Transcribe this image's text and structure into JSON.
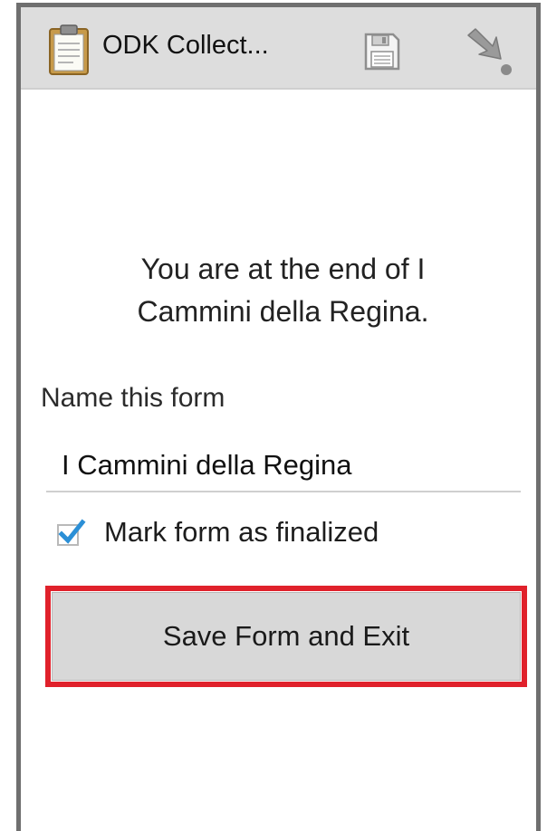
{
  "action_bar": {
    "title": "ODK Collect...",
    "app_icon": "clipboard-icon",
    "save_icon": "floppy-disk-icon",
    "go_icon": "arrow-to-point-icon"
  },
  "end_screen": {
    "message_line1": "You are at the end of I",
    "message_line2": "Cammini della Regina."
  },
  "form_name": {
    "label": "Name this form",
    "value": "I Cammini della Regina"
  },
  "finalize": {
    "label": "Mark form as finalized",
    "checked": true
  },
  "save_button": {
    "label": "Save Form and Exit"
  },
  "colors": {
    "action_bar_bg": "#dddddd",
    "checkbox_accent": "#2b8fd6",
    "highlight_border": "#e0212b",
    "button_bg": "#d8d8d8"
  }
}
